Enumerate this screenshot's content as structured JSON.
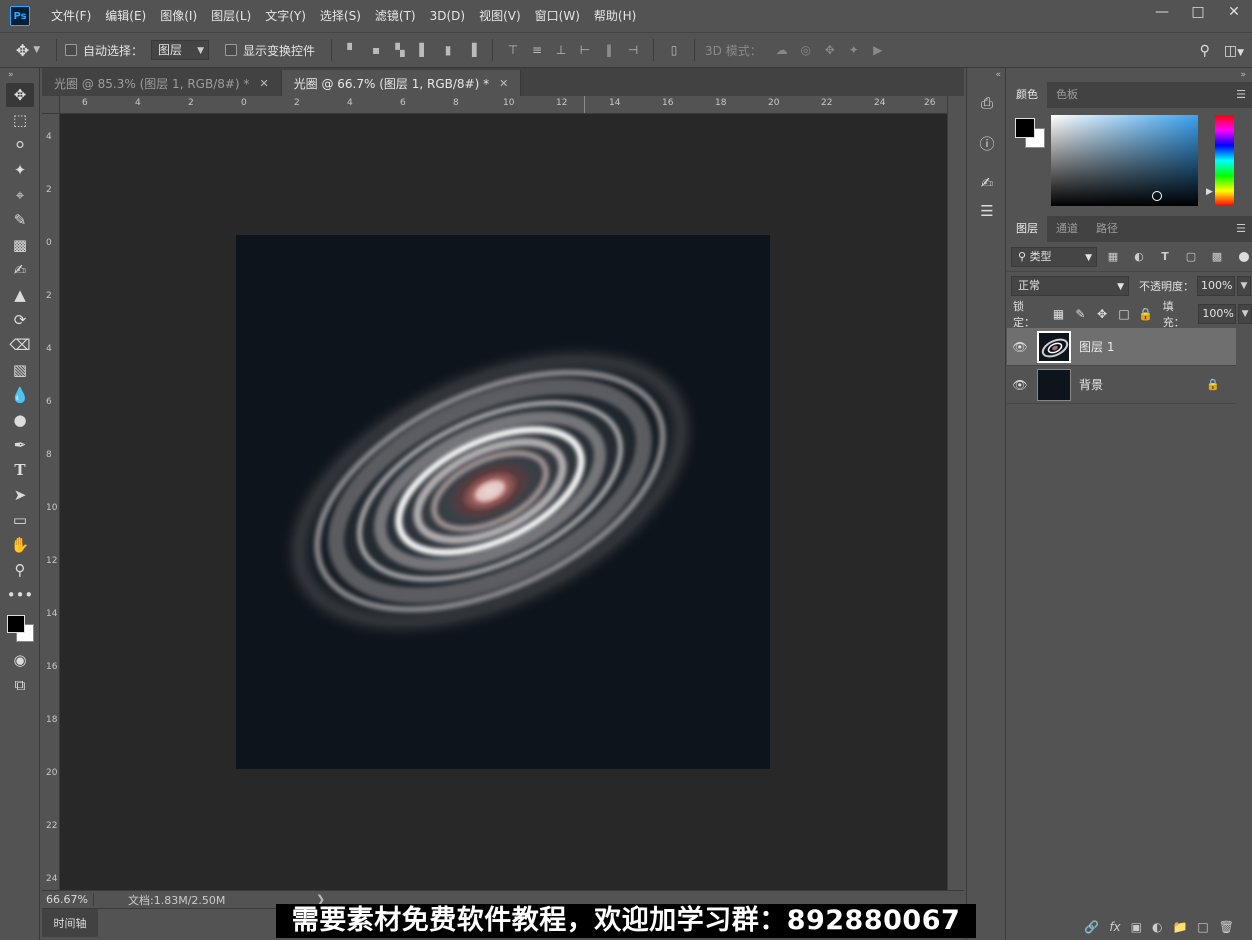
{
  "app": {
    "logo": "Ps"
  },
  "menu": [
    "文件(F)",
    "编辑(E)",
    "图像(I)",
    "图层(L)",
    "文字(Y)",
    "选择(S)",
    "滤镜(T)",
    "3D(D)",
    "视图(V)",
    "窗口(W)",
    "帮助(H)"
  ],
  "options": {
    "auto_select_label": "自动选择：",
    "auto_select_target": "图层",
    "show_transform_label": "显示变换控件",
    "mode_3d_label": "3D 模式："
  },
  "tabs": [
    {
      "label": "光圈 @ 85.3% (图层 1, RGB/8#) *",
      "close": "✕"
    },
    {
      "label": "光圈 @ 66.7% (图层 1, RGB/8#) *",
      "close": "✕"
    }
  ],
  "ruler_top": [
    "6",
    "4",
    "2",
    "0",
    "2",
    "4",
    "6",
    "8",
    "10",
    "12",
    "14",
    "16",
    "18",
    "20",
    "22",
    "24",
    "26"
  ],
  "ruler_left": [
    "4",
    "2",
    "0",
    "2",
    "4",
    "6",
    "8",
    "10",
    "12",
    "14",
    "16",
    "18",
    "20",
    "22",
    "24"
  ],
  "status": {
    "zoom": "66.67%",
    "doc_info": "文档:1.83M/2.50M",
    "arrow": "❯"
  },
  "timeline_tab": "时间轴",
  "color_panel": {
    "tabs": [
      "颜色",
      "色板"
    ],
    "foreground": "#000000",
    "background": "#ffffff"
  },
  "layers_panel": {
    "tabs": [
      "图层",
      "通道",
      "路径"
    ],
    "kind_filter": "类型",
    "blend_mode": "正常",
    "opacity_label": "不透明度：",
    "opacity_value": "100%",
    "lock_label": "锁定：",
    "fill_label": "填充：",
    "fill_value": "100%",
    "layers": [
      {
        "name": "图层 1",
        "selected": true,
        "visible": true,
        "locked": false
      },
      {
        "name": "背景",
        "selected": false,
        "visible": true,
        "locked": true
      }
    ],
    "footer_icons": [
      "link-icon",
      "fx-icon",
      "mask-icon",
      "adjustment-icon",
      "folder-icon",
      "new-layer-icon",
      "trash-icon"
    ]
  },
  "banner": "需要素材免费软件教程，欢迎加学习群：892880067",
  "colors": {
    "canvas_bg": "#0e141b",
    "workspace": "#282828",
    "panel": "#535353",
    "accent": "#31a8ff"
  }
}
